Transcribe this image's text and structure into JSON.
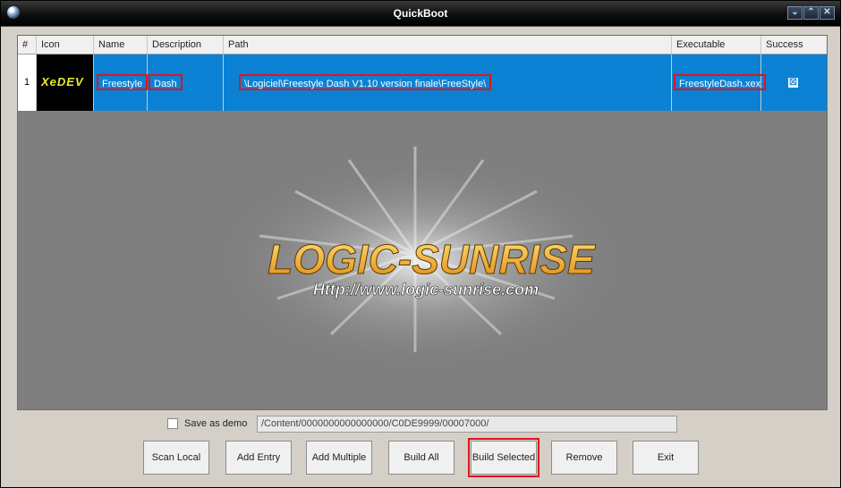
{
  "window": {
    "title": "QuickBoot",
    "buttons": [
      "chevron-down-icon",
      "chevron-up-icon",
      "close-icon"
    ]
  },
  "grid": {
    "columns": [
      "#",
      "Icon",
      "Name",
      "Description",
      "Path",
      "Executable",
      "Success"
    ],
    "rows": [
      {
        "num": "1",
        "icon_text": "XeDEV",
        "name": "Freestyle",
        "description": "Dash",
        "path": "\\Logiciel\\Freestyle Dash V1.10 version finale\\FreeStyle\\",
        "executable": "FreestyleDash.xex",
        "success": "☒"
      }
    ]
  },
  "watermark": {
    "brand": "LOGIC-SUNRISE",
    "url": "Http://www.logic-sunrise.com"
  },
  "bottom": {
    "save_demo_label": "Save as demo",
    "demo_path": "/Content/0000000000000000/C0DE9999/00007000/",
    "buttons": {
      "scan_local": "Scan Local",
      "add_entry": "Add Entry",
      "add_multiple": "Add Multiple",
      "build_all": "Build All",
      "build_selected": "Build Selected",
      "remove": "Remove",
      "exit": "Exit"
    }
  },
  "colors": {
    "selection": "#0b81d3",
    "highlight": "#e0141e",
    "grid_bg": "#7f7f7f"
  }
}
